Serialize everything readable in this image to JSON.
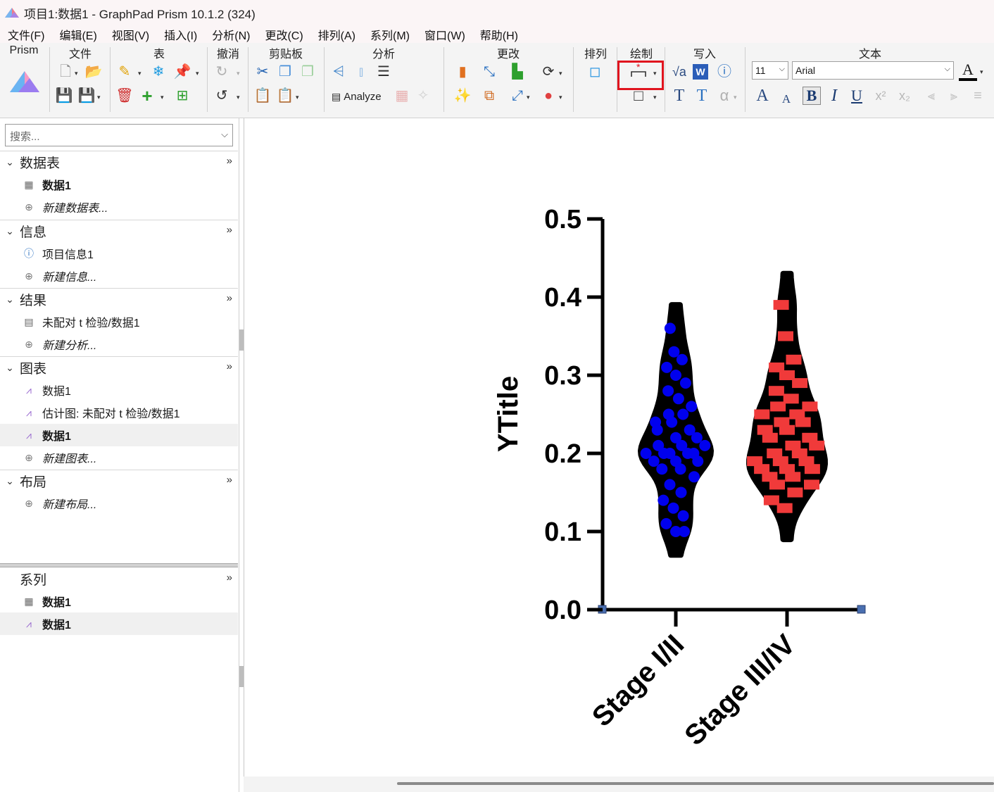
{
  "window": {
    "title": "项目1:数据1 - GraphPad Prism 10.1.2 (324)"
  },
  "menu": [
    "文件(F)",
    "编辑(E)",
    "视图(V)",
    "插入(I)",
    "分析(N)",
    "更改(C)",
    "排列(A)",
    "系列(M)",
    "窗口(W)",
    "帮助(H)"
  ],
  "ribbon": {
    "groups": {
      "prism": "Prism",
      "file": "文件",
      "table": "表",
      "undo": "撤消",
      "clipboard": "剪贴板",
      "analysis": "分析",
      "change": "更改",
      "arrange": "排列",
      "draw": "绘制",
      "write": "写入",
      "text": "文本"
    },
    "analyze_label": "Analyze",
    "font_size": "11",
    "font_name": "Arial"
  },
  "sidebar": {
    "search_placeholder": "搜索...",
    "sections": {
      "data_tables": {
        "title": "数据表",
        "items": [
          "数据1"
        ],
        "new_label": "新建数据表..."
      },
      "info": {
        "title": "信息",
        "items": [
          "项目信息1"
        ],
        "new_label": "新建信息..."
      },
      "results": {
        "title": "结果",
        "items": [
          "未配对 t 检验/数据1"
        ],
        "new_label": "新建分析..."
      },
      "graphs": {
        "title": "图表",
        "items": [
          "数据1",
          "估计图: 未配对 t 检验/数据1",
          "数据1"
        ],
        "new_label": "新建图表..."
      },
      "layouts": {
        "title": "布局",
        "new_label": "新建布局..."
      },
      "series": {
        "title": "系列",
        "items": [
          "数据1",
          "数据1"
        ]
      }
    }
  },
  "colors": {
    "series1": "#0000ee",
    "series2": "#f03a3a",
    "highlight": "#e0141e"
  },
  "chart_data": {
    "type": "violin",
    "ylabel": "YTitle",
    "ylim": [
      0,
      0.5
    ],
    "yticks": [
      "0.0",
      "0.1",
      "0.2",
      "0.3",
      "0.4",
      "0.5"
    ],
    "categories": [
      "Stage I/II",
      "Stage III/IV"
    ],
    "series": [
      {
        "marker": "circle",
        "range": [
          0.07,
          0.39
        ],
        "points": [
          0.36,
          0.33,
          0.32,
          0.31,
          0.3,
          0.29,
          0.28,
          0.27,
          0.26,
          0.25,
          0.25,
          0.24,
          0.24,
          0.23,
          0.23,
          0.22,
          0.22,
          0.21,
          0.21,
          0.21,
          0.2,
          0.2,
          0.2,
          0.2,
          0.2,
          0.19,
          0.19,
          0.19,
          0.18,
          0.18,
          0.17,
          0.16,
          0.15,
          0.14,
          0.13,
          0.12,
          0.11,
          0.1,
          0.1
        ]
      },
      {
        "marker": "square",
        "range": [
          0.09,
          0.43
        ],
        "points": [
          0.39,
          0.35,
          0.32,
          0.31,
          0.3,
          0.29,
          0.28,
          0.27,
          0.26,
          0.26,
          0.25,
          0.25,
          0.24,
          0.24,
          0.23,
          0.23,
          0.22,
          0.22,
          0.21,
          0.21,
          0.2,
          0.2,
          0.19,
          0.19,
          0.19,
          0.18,
          0.18,
          0.18,
          0.17,
          0.17,
          0.16,
          0.16,
          0.15,
          0.14,
          0.13
        ]
      }
    ]
  }
}
